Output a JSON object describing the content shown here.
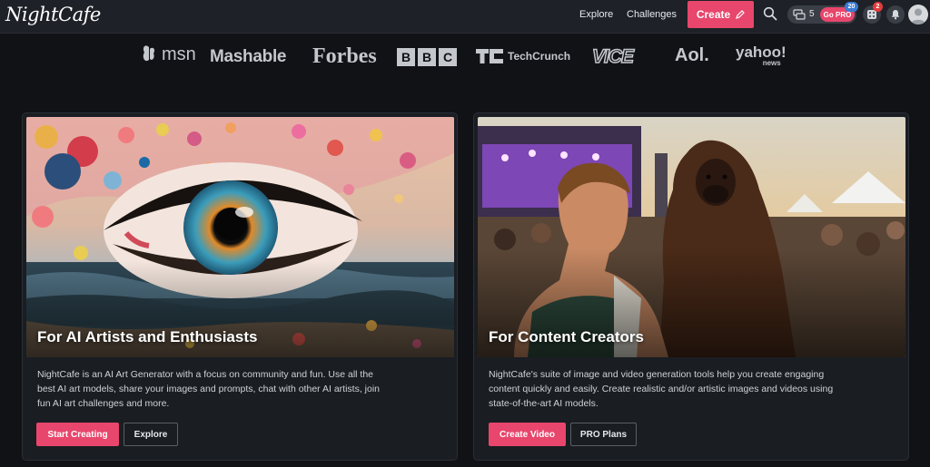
{
  "header": {
    "logo": "NightCafe",
    "nav": {
      "explore": "Explore",
      "challenges": "Challenges"
    },
    "create_label": "Create",
    "credits_count": "5",
    "go_pro_label": "Go PRO",
    "pro_badge_count": "20",
    "dice_badge_count": "2",
    "colors": {
      "accent": "#e8466c",
      "topbar": "#1e2127",
      "badge_blue": "#3a7bd5",
      "badge_red": "#e23c3c"
    }
  },
  "press": {
    "msn": "msn",
    "mashable": "Mashable",
    "forbes": "Forbes",
    "bbc": [
      "B",
      "B",
      "C"
    ],
    "techcrunch": "TechCrunch",
    "vice": "VICE",
    "aol": "Aol.",
    "yahoo": "yahoo!",
    "yahoo_sub": "news"
  },
  "cards": [
    {
      "title": "For AI Artists and Enthusiasts",
      "description": "NightCafe is an AI Art Generator with a focus on community and fun. Use all the best AI art models, share your images and prompts, chat with other AI artists, join fun AI art challenges and more.",
      "primary_button": "Start Creating",
      "secondary_button": "Explore"
    },
    {
      "title": "For Content Creators",
      "description": "NightCafe's suite of image and video generation tools help you create engaging content quickly and easily. Create realistic and/or artistic images and videos using state-of-the-art AI models.",
      "primary_button": "Create Video",
      "secondary_button": "PRO Plans"
    }
  ],
  "icons": {
    "create": "pencil-icon",
    "search": "search-icon",
    "credits": "coin-stack-icon",
    "dice": "dice-icon",
    "bell": "bell-icon",
    "avatar": "user-avatar-icon"
  }
}
